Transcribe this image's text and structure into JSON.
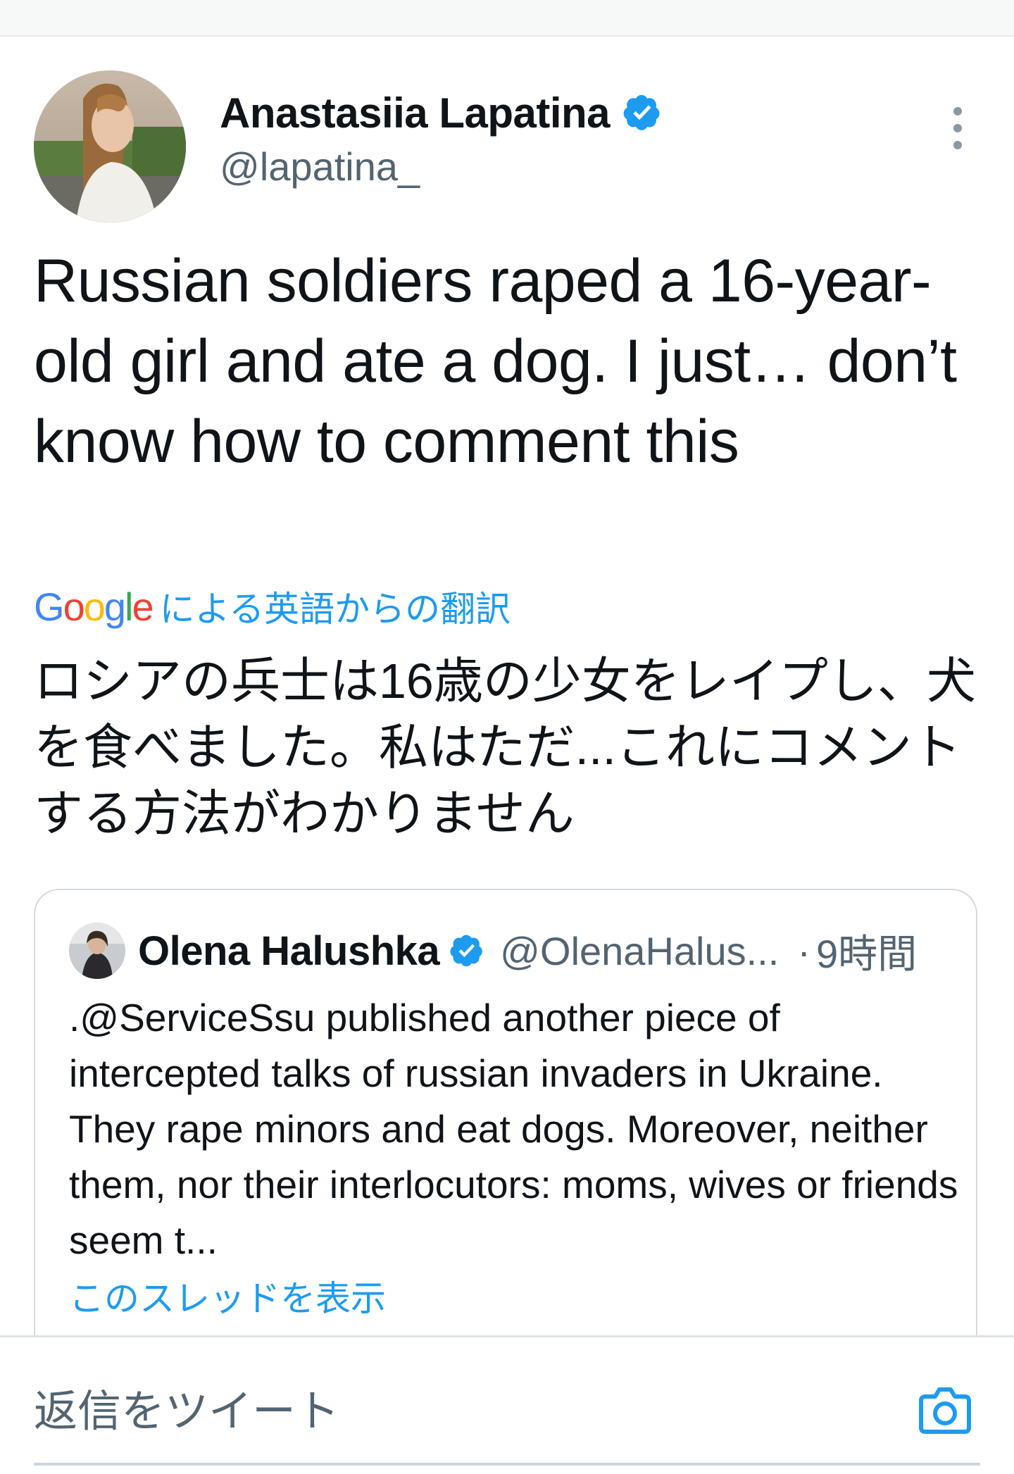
{
  "tweet": {
    "author_name": "Anastasiia Lapatina",
    "author_handle": "@lapatina_",
    "text": "Russian soldiers raped a 16-year-old girl and ate a dog. I just… don’t know how to comment this",
    "translation": {
      "google_logo_letters": [
        "G",
        "o",
        "o",
        "g",
        "l",
        "e"
      ],
      "label": "による英語からの翻訳",
      "text": "ロシアの兵士は16歳の少女をレイプし、犬を食べました。私はただ...これにコメントする方法がわかりません"
    },
    "icons": {
      "verified": "verified-badge-icon",
      "more": "more-options-icon"
    },
    "colors": {
      "accent": "#1d9bf0",
      "secondary_text": "#536471",
      "google_blue": "#4285f4",
      "google_red": "#ea4335",
      "google_yellow": "#fbbc05",
      "google_green": "#34a853"
    }
  },
  "quoted_tweet": {
    "author_name": "Olena Halushka",
    "author_handle": "@OlenaHalus...",
    "separator": "·",
    "timestamp": "9時間",
    "text": ".@ServiceSsu published another piece of intercepted talks of russian invaders in Ukraine. They rape minors and eat dogs. Moreover, neither them, nor their interlocutors: moms, wives or friends seem t...",
    "show_thread_label": "このスレッドを表示"
  },
  "reply_bar": {
    "placeholder": "返信をツイート",
    "camera_icon": "camera-icon"
  }
}
